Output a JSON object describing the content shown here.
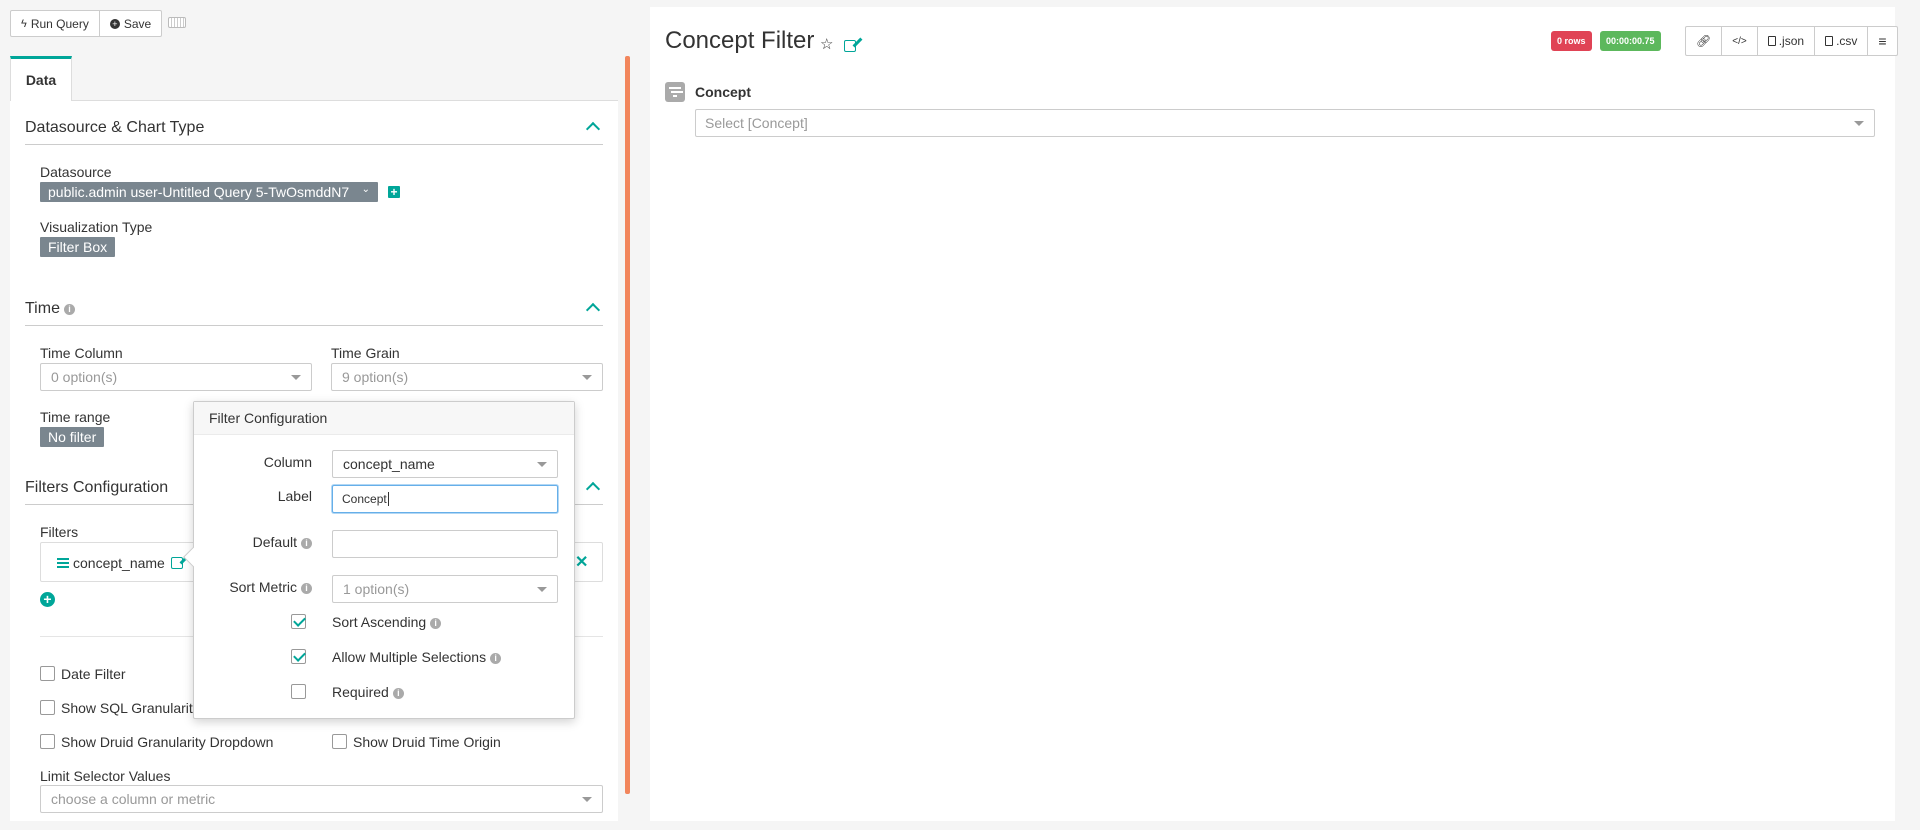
{
  "toolbar": {
    "run_query_label": "Run Query",
    "save_label": "Save"
  },
  "tabs": [
    {
      "label": "Data"
    }
  ],
  "datasource_section": {
    "title": "Datasource & Chart Type",
    "datasource_label": "Datasource",
    "datasource_value": "public.admin user-Untitled Query 5-TwOsmddN7",
    "viz_type_label": "Visualization Type",
    "viz_type_value": "Filter Box"
  },
  "time_section": {
    "title": "Time",
    "time_column_label": "Time Column",
    "time_column_placeholder": "0 option(s)",
    "time_grain_label": "Time Grain",
    "time_grain_placeholder": "9 option(s)",
    "time_range_label": "Time range",
    "time_range_value": "No filter"
  },
  "filters_section": {
    "title": "Filters Configuration",
    "filters_label": "Filters",
    "filter_items": [
      {
        "label": "concept_name"
      }
    ],
    "date_filter_label": "Date Filter",
    "show_sql_granularity_label": "Show SQL Granularit",
    "show_druid_granularity_label": "Show Druid Granularity Dropdown",
    "show_druid_time_origin_label": "Show Druid Time Origin",
    "limit_selector_label": "Limit Selector Values",
    "limit_selector_placeholder": "choose a column or metric"
  },
  "popover": {
    "title": "Filter Configuration",
    "column_label": "Column",
    "column_value": "concept_name",
    "label_label": "Label",
    "label_value": "Concept",
    "default_label": "Default",
    "default_value": "",
    "sort_metric_label": "Sort Metric",
    "sort_metric_placeholder": "1 option(s)",
    "sort_ascending_label": "Sort Ascending",
    "sort_ascending_checked": true,
    "allow_multiple_label": "Allow Multiple Selections",
    "allow_multiple_checked": true,
    "required_label": "Required",
    "required_checked": false
  },
  "chart": {
    "title": "Concept Filter",
    "rows_badge": "0 rows",
    "time_badge": "00:00:00.75",
    "json_label": ".json",
    "csv_label": ".csv",
    "filter_label": "Concept",
    "filter_placeholder": "Select [Concept]"
  },
  "colors": {
    "accent": "#00a699",
    "scrollbar": "#f2865c",
    "rows_badge": "#e04355",
    "time_badge": "#5cb85c",
    "tag_bg": "#7a868f"
  }
}
